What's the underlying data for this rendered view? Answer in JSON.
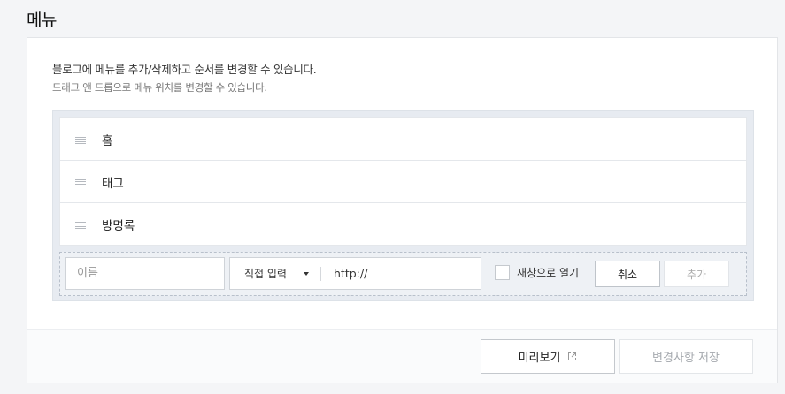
{
  "page": {
    "title": "메뉴"
  },
  "description": {
    "line1": "블로그에 메뉴를 추가/삭제하고 순서를 변경할 수 있습니다.",
    "line2": "드래그 앤 드롭으로 메뉴 위치를 변경할 수 있습니다."
  },
  "menu_items": [
    {
      "label": "홈"
    },
    {
      "label": "태그"
    },
    {
      "label": "방명록"
    }
  ],
  "add_form": {
    "name_placeholder": "이름",
    "type_select_value": "직접 입력",
    "url_value": "http://",
    "new_window_label": "새창으로 열기",
    "new_window_checked": false,
    "cancel_label": "취소",
    "add_label": "추가"
  },
  "footer": {
    "preview_label": "미리보기",
    "save_label": "변경사항 저장"
  },
  "colors": {
    "menu_area_bg": "#e7ebf1",
    "disabled_text": "#a5a9ae"
  }
}
